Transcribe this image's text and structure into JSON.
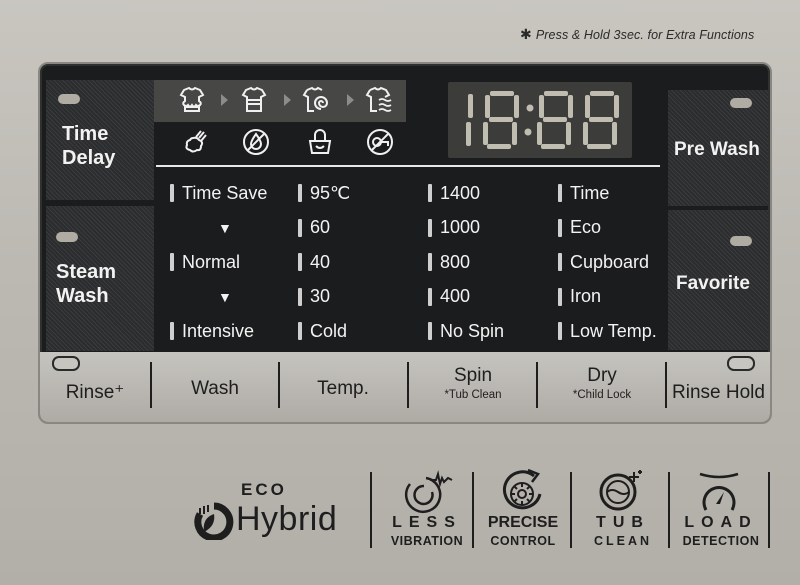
{
  "hint": {
    "star": "✱",
    "text": "Press & Hold 3sec. for Extra Functions"
  },
  "side_buttons": {
    "time_delay": {
      "line1": "Time",
      "line2": "Delay"
    },
    "steam_wash": {
      "line1": "Steam",
      "line2": "Wash"
    },
    "pre_wash": "Pre Wash",
    "favorite": "Favorite"
  },
  "stage_icons": [
    "prewash-shirt-icon",
    "wash-shirt-icon",
    "spin-shirt-icon",
    "rinse-shirt-icon"
  ],
  "option_icons": [
    "steam-icon",
    "no-water-icon",
    "child-lock-icon",
    "no-spin-icon"
  ],
  "display": {
    "digits": "18:88",
    "colon": ":"
  },
  "columns": {
    "course": [
      "Time Save",
      "▼",
      "Normal",
      "▼",
      "Intensive"
    ],
    "temp": [
      "95℃",
      "60",
      "40",
      "30",
      "Cold"
    ],
    "spin": [
      "1400",
      "1000",
      "800",
      "400",
      "No Spin"
    ],
    "dry": [
      "Time",
      "Eco",
      "Cupboard",
      "Iron",
      "Low Temp."
    ]
  },
  "bottom_buttons": [
    {
      "main": "Rinse⁺",
      "sub": ""
    },
    {
      "main": "Wash",
      "sub": ""
    },
    {
      "main": "Temp.",
      "sub": ""
    },
    {
      "main": "Spin",
      "sub": "*Tub Clean"
    },
    {
      "main": "Dry",
      "sub": "*Child Lock"
    },
    {
      "main": "Rinse Hold",
      "sub": ""
    }
  ],
  "features": {
    "eco": "ECO",
    "hybrid": "Hybrid",
    "less_top": "LESS",
    "less_bot": "VIBRATION",
    "precise_top": "PRECISE",
    "precise_bot": "CONTROL",
    "tub_top": "TUB",
    "tub_bot": "CLEAN",
    "load_top": "LOAD",
    "load_bot": "DETECTION"
  },
  "colors": {
    "panel": "#1b1c1d",
    "text_light": "#f3f3f3",
    "housing": "#bcb9b3",
    "led": "#b0aca4"
  }
}
